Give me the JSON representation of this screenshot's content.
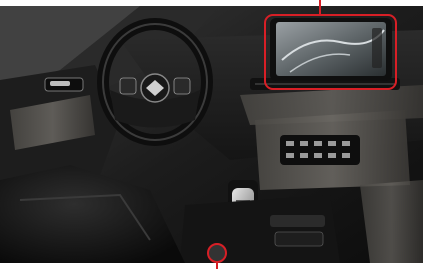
{
  "image": {
    "subject": "car interior",
    "annotation_color": "#d81f26"
  },
  "callouts": [
    {
      "target": "infotainment-screen"
    },
    {
      "target": "center-console-control"
    }
  ]
}
